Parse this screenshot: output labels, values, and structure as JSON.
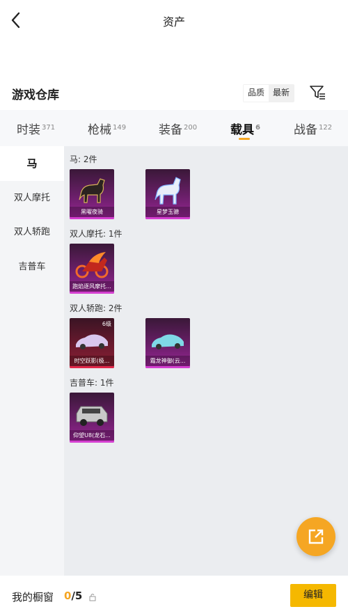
{
  "header": {
    "title": "资产"
  },
  "warehouse": {
    "title": "游戏仓库",
    "sort": [
      "品质",
      "最新"
    ]
  },
  "tabs": [
    {
      "label": "时装",
      "count": "371"
    },
    {
      "label": "枪械",
      "count": "149"
    },
    {
      "label": "装备",
      "count": "200"
    },
    {
      "label": "载具",
      "count": "6"
    },
    {
      "label": "战备",
      "count": "122"
    }
  ],
  "sidebar": [
    "马",
    "双人摩托",
    "双人轿跑",
    "吉普车"
  ],
  "sections": [
    {
      "label": "马: 2件",
      "items": [
        {
          "name": "黑曜夜骑"
        },
        {
          "name": "星梦玉骢"
        }
      ]
    },
    {
      "label": "双人摩托: 1件",
      "items": [
        {
          "name": "跑焰逐风摩托..."
        }
      ]
    },
    {
      "label": "双人轿跑: 2件",
      "items": [
        {
          "name": "时空跃影(极...",
          "level": "6级"
        },
        {
          "name": "霜龙神御(云..."
        }
      ]
    },
    {
      "label": "吉普车: 1件",
      "items": [
        {
          "name": "仰望U8(龙石..."
        }
      ]
    }
  ],
  "footer": {
    "label": "我的橱窗",
    "count_current": "0",
    "count_total": "/5",
    "edit": "编辑"
  },
  "colors": {
    "accent": "#f5a623",
    "card_purple": "#6b1f6a",
    "card_red": "#6b1a2e"
  }
}
